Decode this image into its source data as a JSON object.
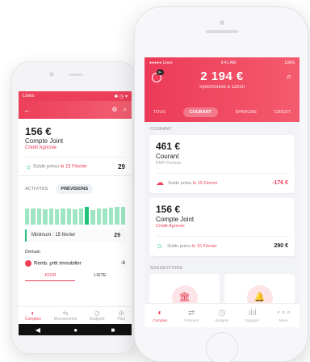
{
  "android": {
    "status_left": "Lines",
    "status_right": "✱ ◷ ▾",
    "card": {
      "amount": "156 €",
      "name": "Compte Joint",
      "bank": "Crédit Agricole",
      "solde_prefix": "Solde prévu",
      "solde_date": "le 15 Février",
      "solde_value": "29"
    },
    "tabs": [
      "ACTIVITÉS",
      "PRÉVISIONS"
    ],
    "minimum_label": "Minimum : 15 février",
    "minimum_value": "29",
    "detail_label": "Demain",
    "loan_label": "Remb. prêt immobilier",
    "loan_value": "-6",
    "segments": [
      "JOUR",
      "LISTE"
    ],
    "bottom_nav": [
      {
        "label": "Comptes",
        "icon": "pie-icon"
      },
      {
        "label": "Mouvements",
        "icon": "arrows-icon"
      },
      {
        "label": "Budgets",
        "icon": "clock-icon"
      },
      {
        "label": "Plus",
        "icon": "chart-icon"
      }
    ]
  },
  "iphone": {
    "status_left": "●●●●● Lines",
    "status_time": "9:41 AM",
    "status_right": "100%",
    "notif_count": "9+",
    "balance": "2 194 €",
    "sync_text": "Synchronisé à 12h20",
    "tabs": [
      "TOUS",
      "COURANT",
      "ÉPARGNE",
      "CRÉDIT"
    ],
    "section_courant": "COURANT",
    "accounts": [
      {
        "amount": "461 €",
        "name": "Courant",
        "bank": "BNP Paribas",
        "solde_prefix": "Solde prévu",
        "solde_date": "le 15 Février",
        "solde_value": "-176 €"
      },
      {
        "amount": "156 €",
        "name": "Compte Joint",
        "bank": "Crédit Agricole",
        "solde_prefix": "Solde prévu",
        "solde_date": "le 15 Février",
        "solde_value": "290 €"
      }
    ],
    "section_suggestions": "SUGGESTIONS",
    "bottom_nav": [
      {
        "label": "Comptes",
        "icon": "pie-icon"
      },
      {
        "label": "Virement",
        "icon": "arrows-icon"
      },
      {
        "label": "Budgets",
        "icon": "clock-icon"
      },
      {
        "label": "Epargne",
        "icon": "chart-icon"
      },
      {
        "label": "Menu",
        "icon": "dots-icon"
      }
    ]
  },
  "colors": {
    "brand": "#ec3f5a",
    "positive": "#22c27a"
  }
}
